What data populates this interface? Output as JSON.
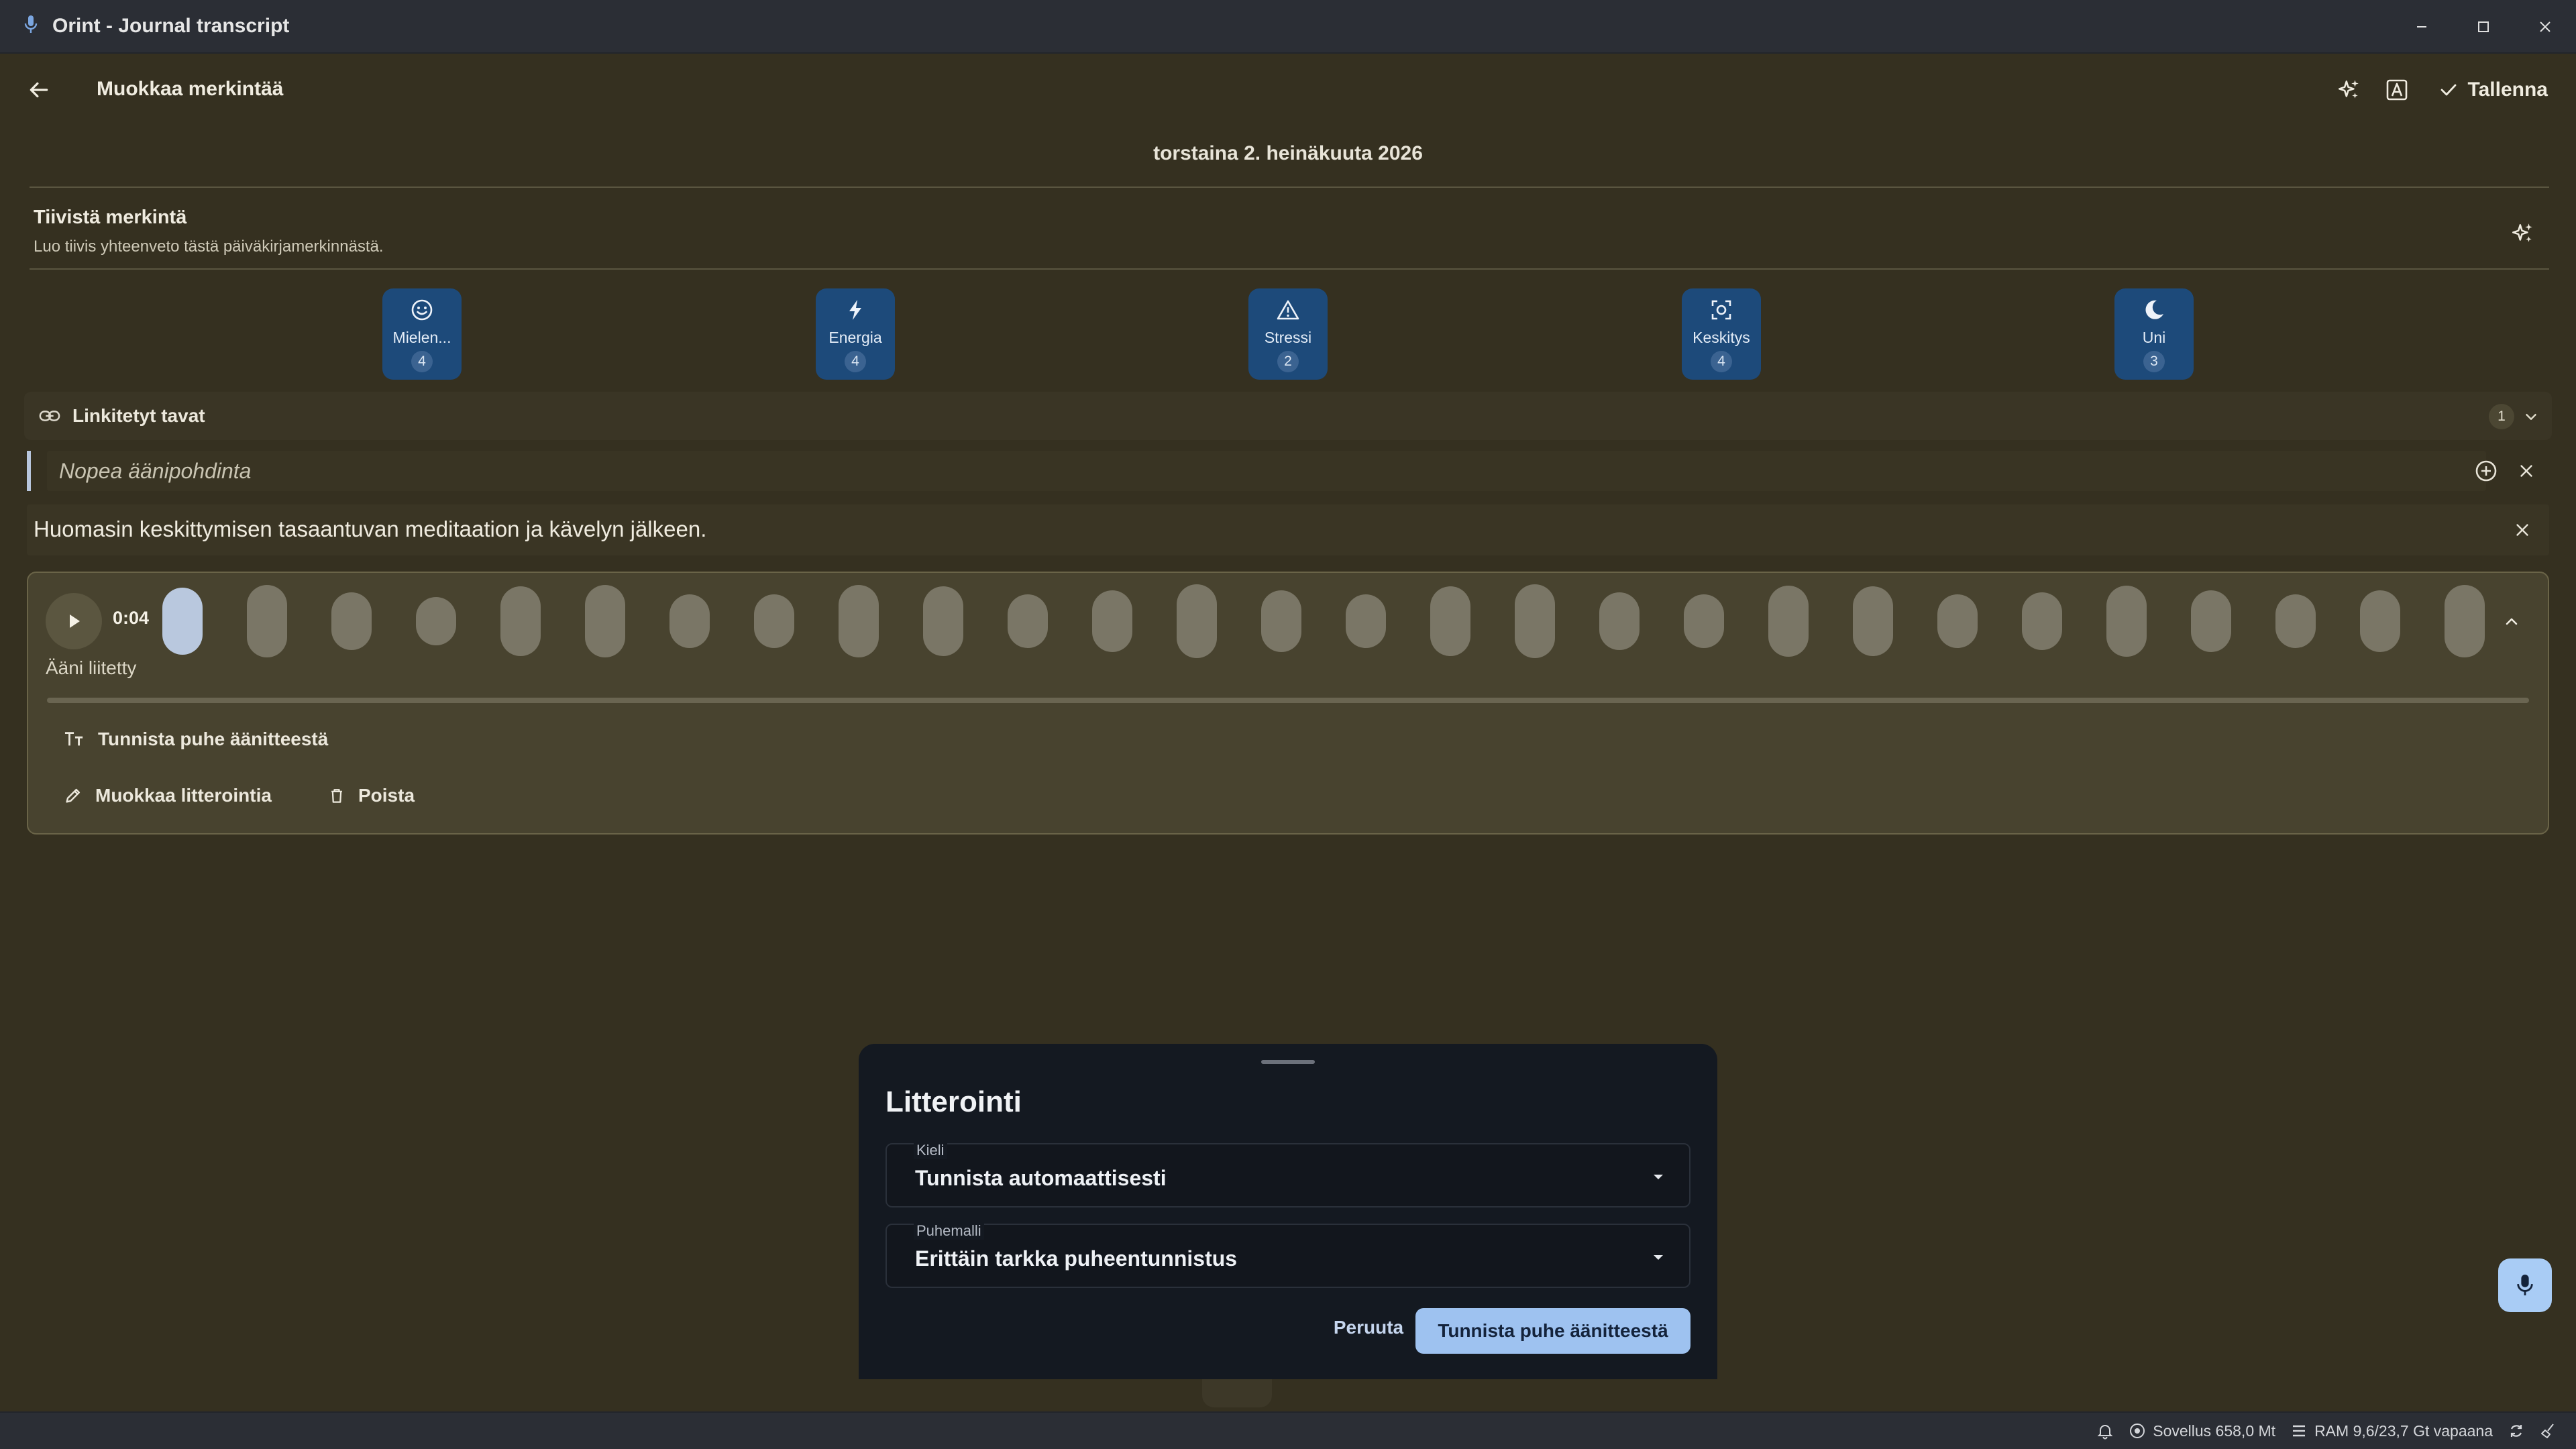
{
  "window": {
    "title": "Orint - Journal transcript",
    "app_icon": "microphone-icon",
    "controls": [
      "minimize-icon",
      "maximize-icon",
      "close-icon"
    ]
  },
  "header": {
    "title": "Muokkaa merkintää",
    "back_icon": "arrow-left-icon",
    "actions": [
      "sparkles-icon",
      "font-icon"
    ],
    "save_label": "Tallenna"
  },
  "entry": {
    "date": "torstaina 2. heinäkuuta 2026"
  },
  "summary": {
    "title": "Tiivistä merkintä",
    "subtitle": "Luo tiivis yhteenveto tästä päiväkirjamerkinnästä."
  },
  "metrics": [
    {
      "label": "Mielen...",
      "value": "4",
      "icon": "smile-icon"
    },
    {
      "label": "Energia",
      "value": "4",
      "icon": "bolt-icon"
    },
    {
      "label": "Stressi",
      "value": "2",
      "icon": "warning-icon"
    },
    {
      "label": "Keskitys",
      "value": "4",
      "icon": "focus-icon"
    },
    {
      "label": "Uni",
      "value": "3",
      "icon": "moon-icon"
    }
  ],
  "linked_habits": {
    "label": "Linkitetyt tavat",
    "count": "1"
  },
  "quick_reflection": {
    "placeholder": "Nopea äänipohdinta"
  },
  "note": {
    "text": "Huomasin keskittymisen tasaantuvan meditaation ja kävelyn jälkeen."
  },
  "audio": {
    "time": "0:04",
    "attached_label": "Ääni liitetty",
    "progress": 0.0,
    "transcribe_label": "Tunnista puhe äänitteestä",
    "edit_label": "Muokkaa litterointia",
    "delete_label": "Poista"
  },
  "transcription_sheet": {
    "title": "Litterointi",
    "language_label": "Kieli",
    "language_value": "Tunnista automaattisesti",
    "model_label": "Puhemalli",
    "model_value": "Erittäin tarkka puheentunnistus",
    "cancel_label": "Peruuta",
    "confirm_label": "Tunnista puhe äänitteestä"
  },
  "statusbar": {
    "app_usage": "Sovellus 658,0 Mt",
    "ram": "RAM 9,6/23,7 Gt vapaana"
  },
  "colors": {
    "background": "#353020",
    "metric_chip": "#1d4a7a",
    "sheet": "#141921",
    "primary": "#9ec2f0"
  }
}
